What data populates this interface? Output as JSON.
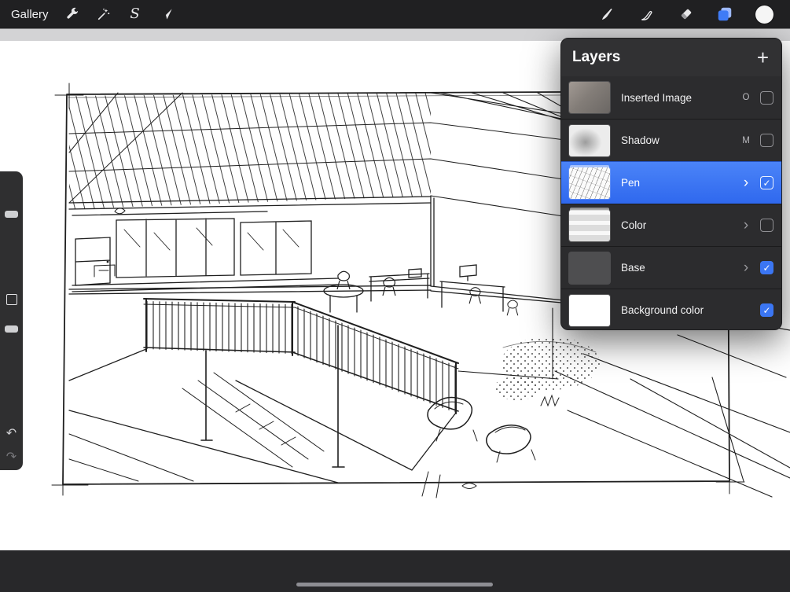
{
  "toolbar": {
    "gallery_label": "Gallery"
  },
  "icons": {
    "selection_glyph": "S",
    "check_glyph": "✓",
    "undo_glyph": "↶",
    "redo_glyph": "↷",
    "add_glyph": "+",
    "chevron_glyph": "›"
  },
  "layers_panel": {
    "title": "Layers",
    "rows": [
      {
        "name": "Inserted Image",
        "right": "O",
        "checked": false,
        "selected": false
      },
      {
        "name": "Shadow",
        "right": "M",
        "checked": false,
        "selected": false
      },
      {
        "name": "Pen",
        "right": "›",
        "checked": true,
        "selected": true
      },
      {
        "name": "Color",
        "right": "›",
        "checked": false,
        "selected": false
      },
      {
        "name": "Base",
        "right": "›",
        "checked": true,
        "selected": false
      },
      {
        "name": "Background color",
        "right": "",
        "checked": true,
        "selected": false
      }
    ]
  },
  "colors": {
    "accent_blue": "#3b76f3",
    "toolbar_bg": "#202022",
    "panel_bg": "#2c2c2e",
    "paper": "#ffffff",
    "canvas_margin": "#d3d3d5"
  }
}
